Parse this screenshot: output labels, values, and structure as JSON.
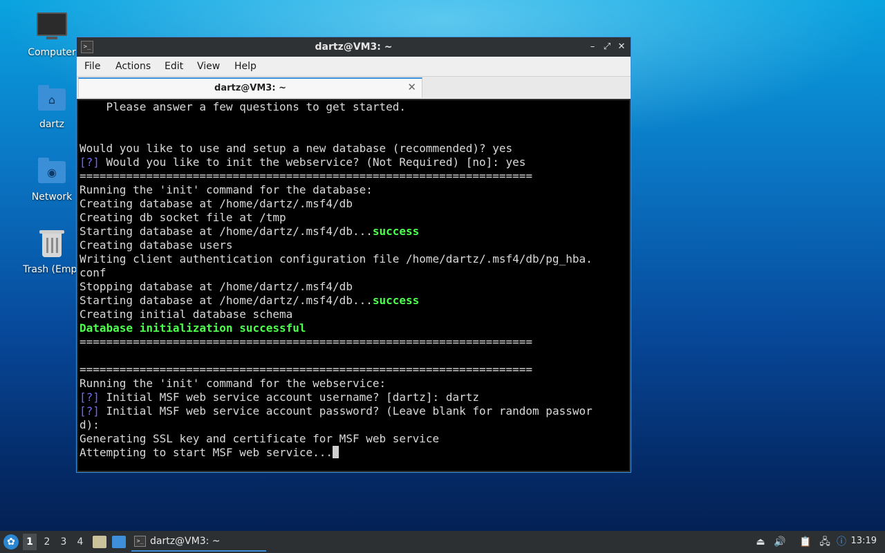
{
  "desktop": {
    "icons": [
      {
        "label": "Computer"
      },
      {
        "label": "dartz"
      },
      {
        "label": "Network"
      },
      {
        "label": "Trash (Empt"
      }
    ]
  },
  "window": {
    "title": "dartz@VM3: ~",
    "menu": [
      "File",
      "Actions",
      "Edit",
      "View",
      "Help"
    ],
    "tab_label": "dartz@VM3: ~",
    "controls": {
      "minimize": "–",
      "maximize": "⤢",
      "close": "✕",
      "tab_close": "✕"
    }
  },
  "terminal": {
    "lines": [
      {
        "pre": "    Please answer a few questions to get started.",
        "mid": "",
        "post": ""
      },
      {
        "pre": "",
        "mid": "",
        "post": ""
      },
      {
        "pre": "",
        "mid": "",
        "post": ""
      },
      {
        "pre": "Would you like to use and setup a new database (recommended)? yes",
        "mid": "",
        "post": ""
      },
      {
        "pre": "",
        "q": "[?]",
        "post": " Would you like to init the webservice? (Not Required) [no]: yes"
      },
      {
        "pre": "====================================================================",
        "mid": "",
        "post": ""
      },
      {
        "pre": "Running the 'init' command for the database:",
        "mid": "",
        "post": ""
      },
      {
        "pre": "Creating database at /home/dartz/.msf4/db",
        "mid": "",
        "post": ""
      },
      {
        "pre": "Creating db socket file at /tmp",
        "mid": "",
        "post": ""
      },
      {
        "pre": "Starting database at /home/dartz/.msf4/db...",
        "ok": "success",
        "post": ""
      },
      {
        "pre": "Creating database users",
        "mid": "",
        "post": ""
      },
      {
        "pre": "Writing client authentication configuration file /home/dartz/.msf4/db/pg_hba.",
        "mid": "",
        "post": ""
      },
      {
        "pre": "conf",
        "mid": "",
        "post": ""
      },
      {
        "pre": "Stopping database at /home/dartz/.msf4/db",
        "mid": "",
        "post": ""
      },
      {
        "pre": "Starting database at /home/dartz/.msf4/db...",
        "ok": "success",
        "post": ""
      },
      {
        "pre": "Creating initial database schema",
        "mid": "",
        "post": ""
      },
      {
        "pre": "",
        "ok": "Database initialization successful",
        "post": ""
      },
      {
        "pre": "====================================================================",
        "mid": "",
        "post": ""
      },
      {
        "pre": "",
        "mid": "",
        "post": ""
      },
      {
        "pre": "====================================================================",
        "mid": "",
        "post": ""
      },
      {
        "pre": "Running the 'init' command for the webservice:",
        "mid": "",
        "post": ""
      },
      {
        "pre": "",
        "q": "[?]",
        "post": " Initial MSF web service account username? [dartz]: dartz"
      },
      {
        "pre": "",
        "q": "[?]",
        "post": " Initial MSF web service account password? (Leave blank for random passwor"
      },
      {
        "pre": "d):",
        "mid": "",
        "post": ""
      },
      {
        "pre": "Generating SSL key and certificate for MSF web service",
        "mid": "",
        "post": ""
      },
      {
        "pre": "Attempting to start MSF web service...",
        "mid": "",
        "post": "",
        "cursor": true
      }
    ]
  },
  "taskbar": {
    "workspaces": [
      "1",
      "2",
      "3",
      "4"
    ],
    "active_workspace": "1",
    "task_label": "dartz@VM3: ~",
    "clock": "13:19",
    "icons": [
      "start-menu-icon",
      "file-manager-icon",
      "show-desktop-icon",
      "eject-icon",
      "volume-icon",
      "clipboard-icon",
      "network-icon",
      "update-notifier-icon"
    ]
  },
  "colors": {
    "accent": "#3c8fd8",
    "prompt": "#6b6bff",
    "success": "#4dff4d",
    "terminal_bg": "#000000"
  }
}
